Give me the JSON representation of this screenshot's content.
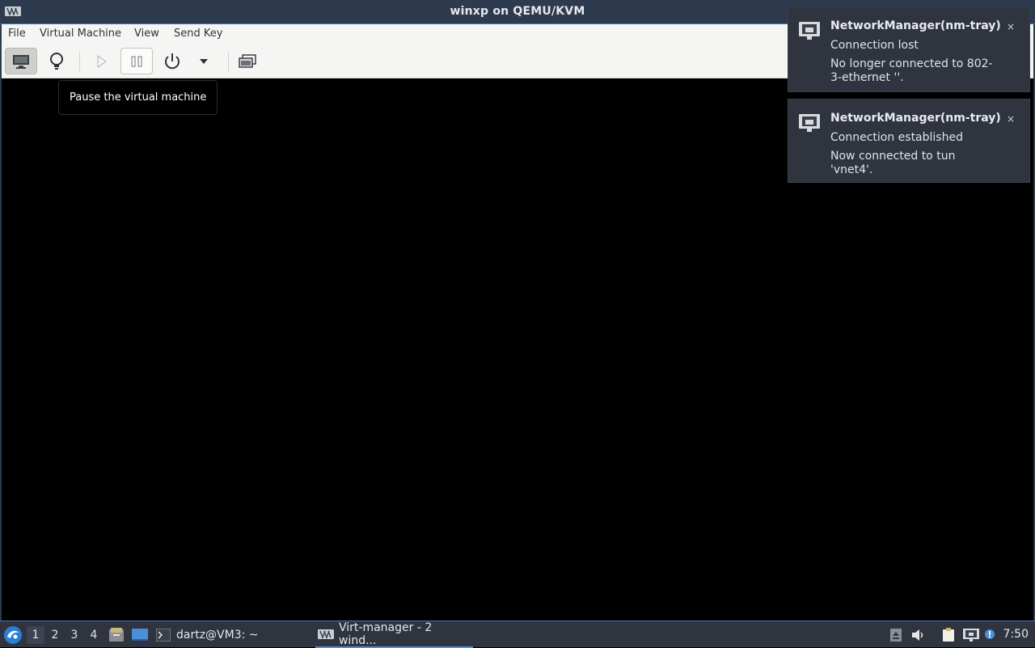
{
  "window": {
    "title": "winxp on QEMU/KVM"
  },
  "menubar": {
    "items": [
      "File",
      "Virtual Machine",
      "View",
      "Send Key"
    ]
  },
  "toolbar": {
    "tooltip": "Pause the virtual machine"
  },
  "notifications": [
    {
      "app": "NetworkManager(nm-tray)",
      "summary": "Connection lost",
      "body": "No longer connected to 802-3-ethernet ''.",
      "close": "×"
    },
    {
      "app": "NetworkManager(nm-tray)",
      "summary": "Connection established",
      "body": "Now connected to tun 'vnet4'.",
      "close": "×"
    }
  ],
  "taskbar": {
    "workspaces": [
      "1",
      "2",
      "3",
      "4"
    ],
    "active_workspace": "1",
    "tasks": [
      {
        "label": "dartz@VM3: ~",
        "icon": "terminal-icon"
      },
      {
        "label": "Virt-manager - 2 wind...",
        "icon": "virt-manager-icon",
        "active": true
      }
    ],
    "clock": "7:50"
  },
  "colors": {
    "titlebar": "#2e3a4e",
    "accent": "#4a90d9",
    "panel": "#2f343f",
    "toolbar": "#f5f5f4"
  }
}
